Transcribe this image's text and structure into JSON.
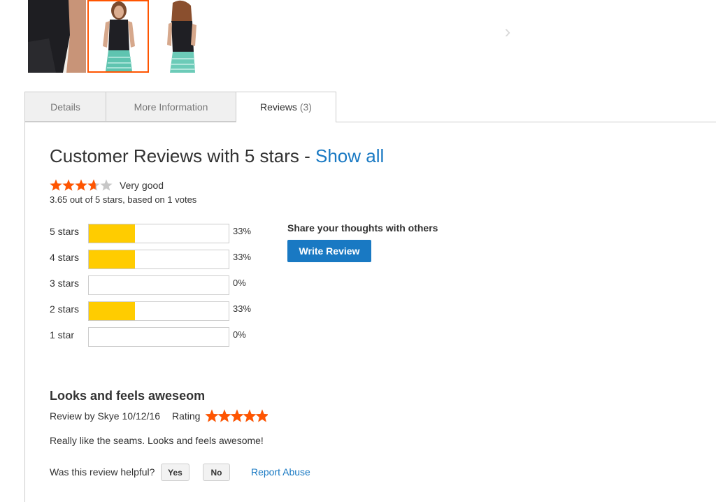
{
  "gallery": {
    "thumbnails": [
      {
        "name": "thumbnail-1"
      },
      {
        "name": "thumbnail-2",
        "selected": true
      },
      {
        "name": "thumbnail-3"
      }
    ],
    "next_icon": "chevron-right-icon"
  },
  "tabs": [
    {
      "label": "Details"
    },
    {
      "label": "More Information"
    },
    {
      "label": "Reviews",
      "count": "(3)",
      "active": true
    }
  ],
  "summary": {
    "title_prefix": "Customer Reviews with 5 stars - ",
    "show_all": "Show all",
    "stars": 3.65,
    "rating_word": "Very good",
    "rating_text": "3.65 out of 5 stars, based on 1 votes"
  },
  "breakdown": [
    {
      "label": "5 stars",
      "percent": 33,
      "percent_label": "33%"
    },
    {
      "label": "4 stars",
      "percent": 33,
      "percent_label": "33%"
    },
    {
      "label": "3 stars",
      "percent": 0,
      "percent_label": "0%"
    },
    {
      "label": "2 stars",
      "percent": 33,
      "percent_label": "33%"
    },
    {
      "label": "1 star",
      "percent": 0,
      "percent_label": "0%"
    }
  ],
  "share": {
    "title": "Share your thoughts with others",
    "button": "Write Review"
  },
  "review": {
    "title": "Looks and feels aweseom",
    "meta": "Review by Skye 10/12/16",
    "rating_label": "Rating",
    "stars": 5,
    "body": "Really like the seams. Looks and feels awesome!",
    "helpful_question": "Was this review helpful?",
    "yes": "Yes",
    "no": "No",
    "report": "Report Abuse"
  },
  "colors": {
    "accent": "#1979c3",
    "star": "#ff5501",
    "star_empty": "#c7c7c7",
    "bar_fill": "#ffcc00"
  }
}
